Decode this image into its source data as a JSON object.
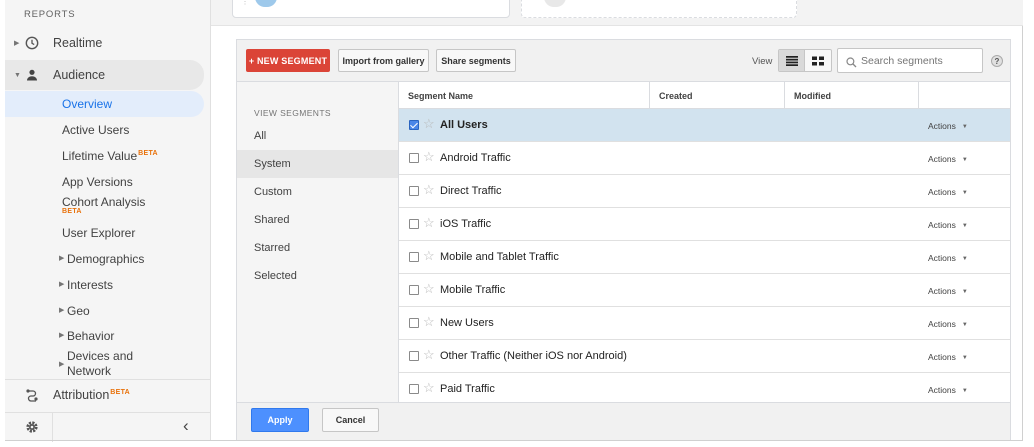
{
  "sidebar": {
    "section_label": "REPORTS",
    "realtime_label": "Realtime",
    "audience_label": "Audience",
    "audience_items": [
      {
        "label": "Overview",
        "beta": ""
      },
      {
        "label": "Active Users",
        "beta": ""
      },
      {
        "label": "Lifetime Value",
        "beta": "BETA"
      },
      {
        "label": "App Versions",
        "beta": ""
      },
      {
        "label": "Cohort Analysis",
        "beta": "BETA"
      },
      {
        "label": "User Explorer",
        "beta": ""
      }
    ],
    "audience_groups": [
      "Demographics",
      "Interests",
      "Geo",
      "Behavior",
      "Devices and Network"
    ],
    "attribution_label": "Attribution",
    "attribution_beta": "BETA",
    "collapse_glyph": "‹"
  },
  "toolbar": {
    "new_segment_label": "+ NEW SEGMENT",
    "import_label": "Import from gallery",
    "share_label": "Share segments",
    "view_label": "View",
    "search_placeholder": "Search segments",
    "help_label": "?"
  },
  "segment_menu": {
    "heading": "VIEW SEGMENTS",
    "items": [
      "All",
      "System",
      "Custom",
      "Shared",
      "Starred",
      "Selected"
    ],
    "active": "System"
  },
  "table": {
    "columns": [
      "Segment Name",
      "Created",
      "Modified",
      ""
    ],
    "rows": [
      {
        "name": "All Users",
        "checked": true,
        "actions": "Actions"
      },
      {
        "name": "Android Traffic",
        "checked": false,
        "actions": "Actions"
      },
      {
        "name": "Direct Traffic",
        "checked": false,
        "actions": "Actions"
      },
      {
        "name": "iOS Traffic",
        "checked": false,
        "actions": "Actions"
      },
      {
        "name": "Mobile and Tablet Traffic",
        "checked": false,
        "actions": "Actions"
      },
      {
        "name": "Mobile Traffic",
        "checked": false,
        "actions": "Actions"
      },
      {
        "name": "New Users",
        "checked": false,
        "actions": "Actions"
      },
      {
        "name": "Other Traffic (Neither iOS nor Android)",
        "checked": false,
        "actions": "Actions"
      },
      {
        "name": "Paid Traffic",
        "checked": false,
        "actions": "Actions"
      }
    ]
  },
  "footer": {
    "apply_label": "Apply",
    "cancel_label": "Cancel"
  },
  "colors": {
    "new_segment": "#db4437",
    "apply": "#4d90fe",
    "selected_row": "#d2e3ef",
    "active_nav": "#1a73e8",
    "beta": "#e8710a"
  },
  "icons": {
    "realtime": "clock-icon",
    "audience": "person-icon",
    "attribution": "attribution-icon",
    "settings": "gear-icon",
    "search": "search-icon",
    "star": "star-outline-icon"
  }
}
